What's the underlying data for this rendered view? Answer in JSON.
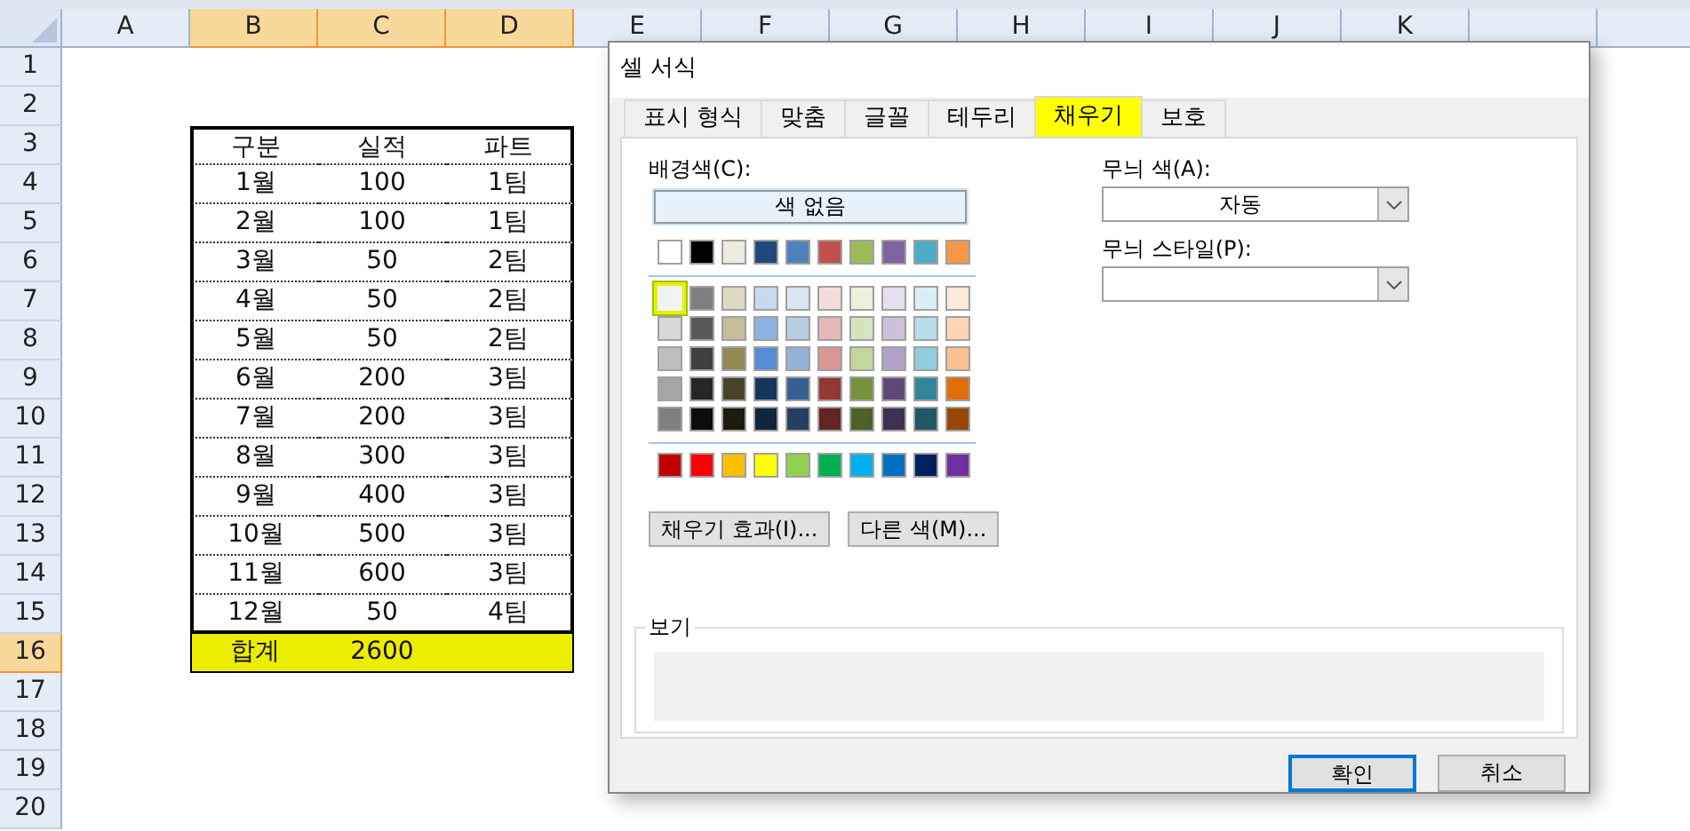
{
  "sheet": {
    "columns": [
      {
        "label": "A",
        "selected": false
      },
      {
        "label": "B",
        "selected": true
      },
      {
        "label": "C",
        "selected": true
      },
      {
        "label": "D",
        "selected": true
      },
      {
        "label": "E",
        "selected": false
      },
      {
        "label": "F",
        "selected": false
      },
      {
        "label": "G",
        "selected": false
      },
      {
        "label": "H",
        "selected": false
      },
      {
        "label": "I",
        "selected": false
      },
      {
        "label": "J",
        "selected": false
      },
      {
        "label": "K",
        "selected": false
      }
    ],
    "rows": [
      {
        "label": "1",
        "selected": false
      },
      {
        "label": "2",
        "selected": false
      },
      {
        "label": "3",
        "selected": false
      },
      {
        "label": "4",
        "selected": false
      },
      {
        "label": "5",
        "selected": false
      },
      {
        "label": "6",
        "selected": false
      },
      {
        "label": "7",
        "selected": false
      },
      {
        "label": "8",
        "selected": false
      },
      {
        "label": "9",
        "selected": false
      },
      {
        "label": "10",
        "selected": false
      },
      {
        "label": "11",
        "selected": false
      },
      {
        "label": "12",
        "selected": false
      },
      {
        "label": "13",
        "selected": false
      },
      {
        "label": "14",
        "selected": false
      },
      {
        "label": "15",
        "selected": false
      },
      {
        "label": "16",
        "selected": true
      },
      {
        "label": "17",
        "selected": false
      },
      {
        "label": "18",
        "selected": false
      },
      {
        "label": "19",
        "selected": false
      },
      {
        "label": "20",
        "selected": false
      }
    ]
  },
  "table": {
    "header": [
      "구분",
      "실적",
      "파트"
    ],
    "rows": [
      [
        "1월",
        "100",
        "1팀"
      ],
      [
        "2월",
        "100",
        "1팀"
      ],
      [
        "3월",
        "50",
        "2팀"
      ],
      [
        "4월",
        "50",
        "2팀"
      ],
      [
        "5월",
        "50",
        "2팀"
      ],
      [
        "6월",
        "200",
        "3팀"
      ],
      [
        "7월",
        "200",
        "3팀"
      ],
      [
        "8월",
        "300",
        "3팀"
      ],
      [
        "9월",
        "400",
        "3팀"
      ],
      [
        "10월",
        "500",
        "3팀"
      ],
      [
        "11월",
        "600",
        "3팀"
      ],
      [
        "12월",
        "50",
        "4팀"
      ]
    ],
    "total": {
      "cells": [
        "합계",
        "2600"
      ],
      "highlighted": true
    }
  },
  "dialog": {
    "title": "셀 서식",
    "tabs": [
      {
        "label": "표시 형식",
        "selected": false
      },
      {
        "label": "맞춤",
        "selected": false
      },
      {
        "label": "글꼴",
        "selected": false
      },
      {
        "label": "테두리",
        "selected": false
      },
      {
        "label": "채우기",
        "selected": true
      },
      {
        "label": "보호",
        "selected": false
      }
    ],
    "background_label": "배경색(C):",
    "no_color_button": "색 없음",
    "theme_colors": [
      {
        "color": "#ffffff",
        "selected": false
      },
      {
        "color": "#000000",
        "selected": false
      },
      {
        "color": "#eeece1",
        "selected": false
      },
      {
        "color": "#1f497d",
        "selected": false
      },
      {
        "color": "#4f81bd",
        "selected": false
      },
      {
        "color": "#c0504d",
        "selected": false
      },
      {
        "color": "#9bbb59",
        "selected": false
      },
      {
        "color": "#8064a2",
        "selected": false
      },
      {
        "color": "#4bacc6",
        "selected": false
      },
      {
        "color": "#f79646",
        "selected": false
      }
    ],
    "shade_rows": [
      [
        {
          "color": "#f2f2f2",
          "selected": true
        },
        {
          "color": "#7f7f7f",
          "selected": false
        },
        {
          "color": "#ddd9c3",
          "selected": false
        },
        {
          "color": "#c6d9f0",
          "selected": false
        },
        {
          "color": "#dbe5f1",
          "selected": false
        },
        {
          "color": "#f2dcdb",
          "selected": false
        },
        {
          "color": "#ebf1dd",
          "selected": false
        },
        {
          "color": "#e5e0ec",
          "selected": false
        },
        {
          "color": "#dbeef3",
          "selected": false
        },
        {
          "color": "#fdeada",
          "selected": false
        }
      ],
      [
        {
          "color": "#d8d8d8",
          "selected": false
        },
        {
          "color": "#595959",
          "selected": false
        },
        {
          "color": "#c4bd97",
          "selected": false
        },
        {
          "color": "#8db3e2",
          "selected": false
        },
        {
          "color": "#b8cce4",
          "selected": false
        },
        {
          "color": "#e5b9b7",
          "selected": false
        },
        {
          "color": "#d7e3bc",
          "selected": false
        },
        {
          "color": "#ccc1d9",
          "selected": false
        },
        {
          "color": "#b7dde8",
          "selected": false
        },
        {
          "color": "#fbd5b5",
          "selected": false
        }
      ],
      [
        {
          "color": "#bfbfbf",
          "selected": false
        },
        {
          "color": "#3f3f3f",
          "selected": false
        },
        {
          "color": "#938953",
          "selected": false
        },
        {
          "color": "#548dd4",
          "selected": false
        },
        {
          "color": "#95b3d7",
          "selected": false
        },
        {
          "color": "#d99694",
          "selected": false
        },
        {
          "color": "#c3d69b",
          "selected": false
        },
        {
          "color": "#b2a2c7",
          "selected": false
        },
        {
          "color": "#92cddc",
          "selected": false
        },
        {
          "color": "#fac08f",
          "selected": false
        }
      ],
      [
        {
          "color": "#a5a5a5",
          "selected": false
        },
        {
          "color": "#262626",
          "selected": false
        },
        {
          "color": "#494429",
          "selected": false
        },
        {
          "color": "#17365d",
          "selected": false
        },
        {
          "color": "#366092",
          "selected": false
        },
        {
          "color": "#953734",
          "selected": false
        },
        {
          "color": "#76923c",
          "selected": false
        },
        {
          "color": "#5f497a",
          "selected": false
        },
        {
          "color": "#31859b",
          "selected": false
        },
        {
          "color": "#e36c09",
          "selected": false
        }
      ],
      [
        {
          "color": "#7f7f7f",
          "selected": false
        },
        {
          "color": "#0c0c0c",
          "selected": false
        },
        {
          "color": "#1d1b10",
          "selected": false
        },
        {
          "color": "#0f243e",
          "selected": false
        },
        {
          "color": "#244061",
          "selected": false
        },
        {
          "color": "#632423",
          "selected": false
        },
        {
          "color": "#4f6128",
          "selected": false
        },
        {
          "color": "#3f3151",
          "selected": false
        },
        {
          "color": "#205867",
          "selected": false
        },
        {
          "color": "#974806",
          "selected": false
        }
      ]
    ],
    "standard_colors": [
      {
        "color": "#c00000",
        "selected": false
      },
      {
        "color": "#ff0000",
        "selected": false
      },
      {
        "color": "#ffc000",
        "selected": false
      },
      {
        "color": "#ffff00",
        "selected": false
      },
      {
        "color": "#92d050",
        "selected": false
      },
      {
        "color": "#00b050",
        "selected": false
      },
      {
        "color": "#00b0f0",
        "selected": false
      },
      {
        "color": "#0070c0",
        "selected": false
      },
      {
        "color": "#002060",
        "selected": false
      },
      {
        "color": "#7030a0",
        "selected": false
      }
    ],
    "fill_effects_button": "채우기 효과(I)...",
    "more_colors_button": "다른 색(M)...",
    "pattern_color": {
      "label": "무늬 색(A):",
      "value": "자동"
    },
    "pattern_style": {
      "label": "무늬 스타일(P):"
    },
    "preview_label": "보기",
    "buttons": [
      {
        "label": "확인",
        "kind": "default"
      },
      {
        "label": "취소",
        "kind": "normal"
      }
    ]
  }
}
